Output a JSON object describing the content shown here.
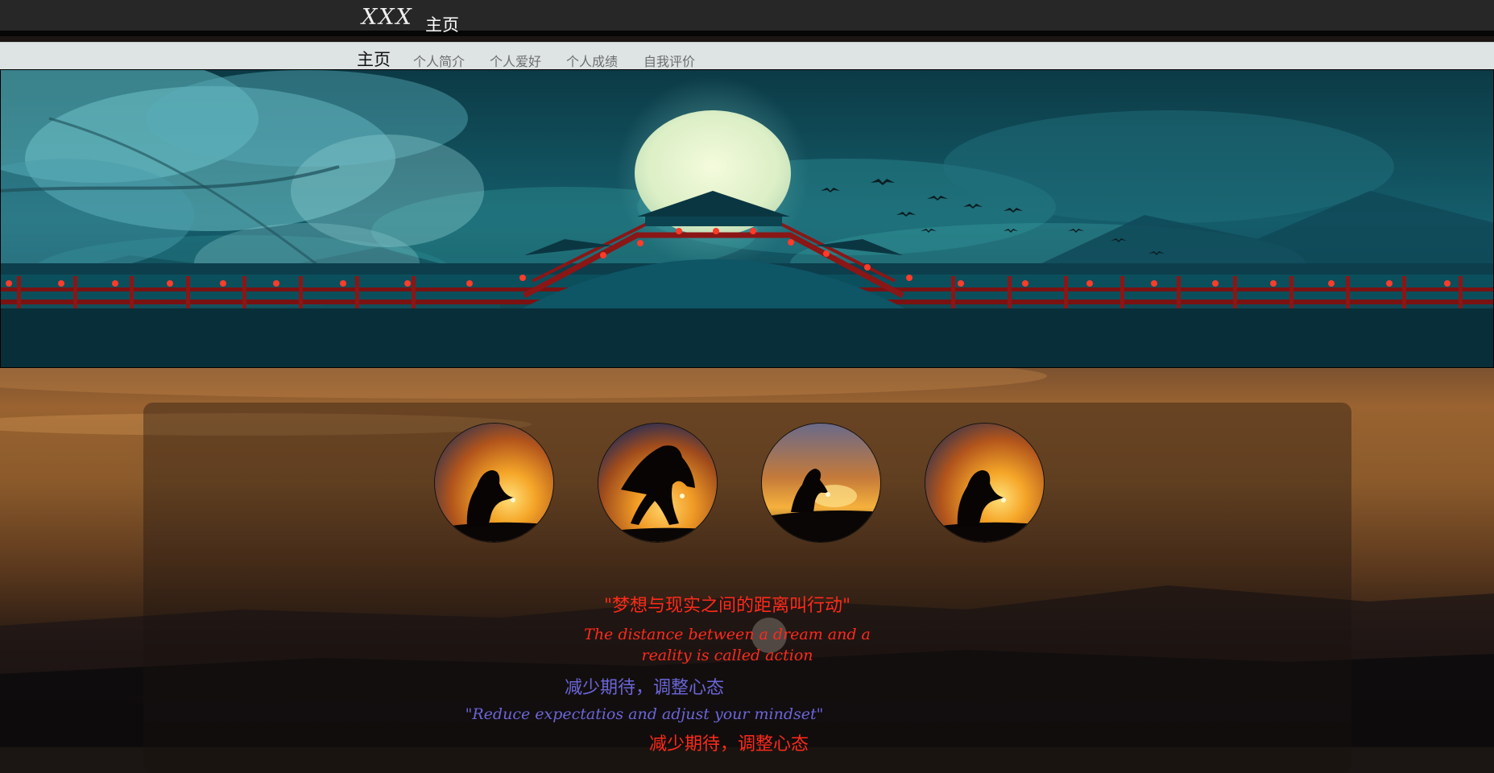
{
  "header": {
    "logo": "XXX",
    "title": "主页"
  },
  "nav": {
    "items": [
      {
        "label": "主页",
        "active": true
      },
      {
        "label": "个人简介",
        "active": false
      },
      {
        "label": "个人爱好",
        "active": false
      },
      {
        "label": "个人成绩",
        "active": false
      },
      {
        "label": "自我评价",
        "active": false
      }
    ]
  },
  "gallery": {
    "count": 4
  },
  "quotes": {
    "q1": "\"梦想与现实之间的距离叫行动\"",
    "q2": "The distance between a dream and a reality is called action",
    "q3": "减少期待，调整心态",
    "q4": "\"Reduce expectatios and adjust your mindset\"",
    "q5": "减少期待，调整心态"
  },
  "colors": {
    "topbar": "#272727",
    "navbar": "#dee3e3",
    "quote_red": "#ff2a1a",
    "quote_blue": "#6a66d8"
  }
}
